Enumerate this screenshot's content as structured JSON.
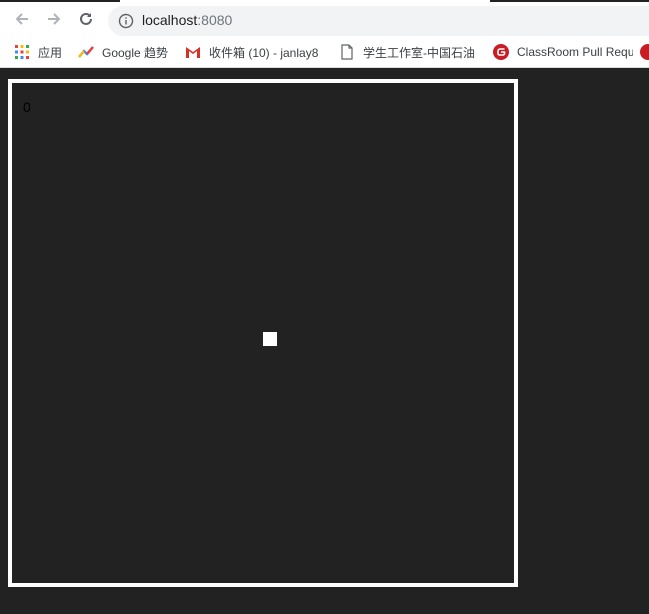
{
  "browser": {
    "url_host": "localhost",
    "url_port": ":8080",
    "bookmarks": [
      {
        "label": "应用",
        "icon": "apps-grid-icon"
      },
      {
        "label": "Google 趋势",
        "icon": "google-trends-icon"
      },
      {
        "label": "收件箱 (10) - janlay8",
        "icon": "gmail-icon"
      },
      {
        "label": "学生工作室-中国石油",
        "icon": "page-icon"
      },
      {
        "label": "ClassRoom Pull Requ",
        "icon": "gitee-icon"
      }
    ]
  },
  "game": {
    "score": "0"
  },
  "colors": {
    "background": "#222222",
    "board_border": "#ffffff",
    "snake": "#ffffff",
    "gitee_red": "#c71d23"
  }
}
